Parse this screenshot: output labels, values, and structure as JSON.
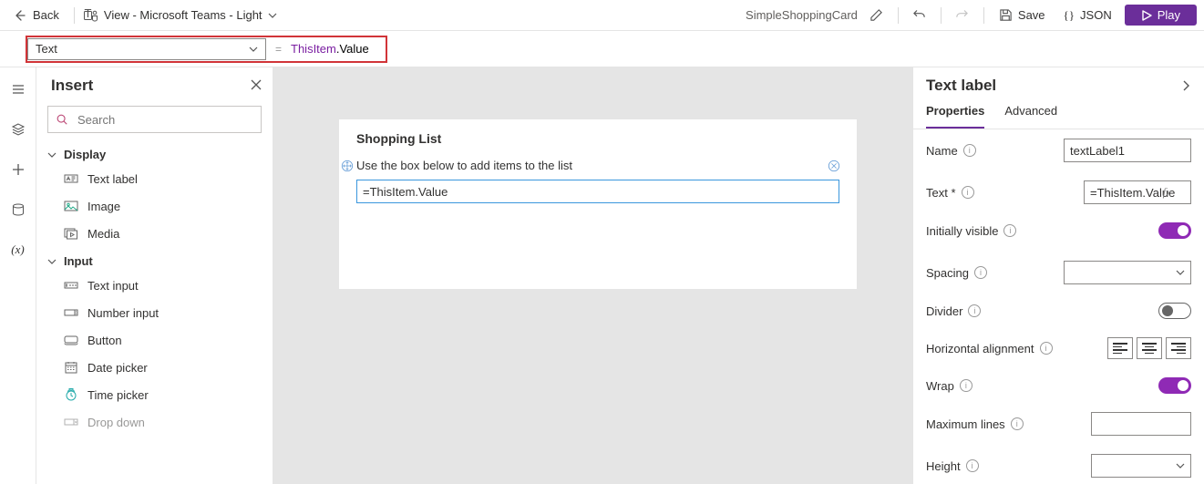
{
  "topbar": {
    "back": "Back",
    "view": "View - Microsoft Teams - Light",
    "appName": "SimpleShoppingCard",
    "save": "Save",
    "json": "JSON",
    "play": "Play"
  },
  "formula": {
    "prop": "Text",
    "tok_this": "ThisItem",
    "tok_prop": ".Value"
  },
  "insert": {
    "title": "Insert",
    "searchPlaceholder": "Search",
    "cat_display": "Display",
    "cat_input": "Input",
    "items_display": [
      "Text label",
      "Image",
      "Media"
    ],
    "items_input": [
      "Text input",
      "Number input",
      "Button",
      "Date picker",
      "Time picker",
      "Drop down"
    ]
  },
  "canvas": {
    "title": "Shopping List",
    "hint": "Use the box below to add items to the list",
    "labelValue": "=ThisItem.Value"
  },
  "props": {
    "title": "Text label",
    "tabs": {
      "properties": "Properties",
      "advanced": "Advanced"
    },
    "name": {
      "label": "Name",
      "value": "textLabel1"
    },
    "text": {
      "label": "Text *",
      "value": "=ThisItem.Value"
    },
    "visible": {
      "label": "Initially visible"
    },
    "spacing": {
      "label": "Spacing"
    },
    "divider": {
      "label": "Divider"
    },
    "halign": {
      "label": "Horizontal alignment"
    },
    "wrap": {
      "label": "Wrap"
    },
    "maxlines": {
      "label": "Maximum lines"
    },
    "height": {
      "label": "Height"
    }
  }
}
